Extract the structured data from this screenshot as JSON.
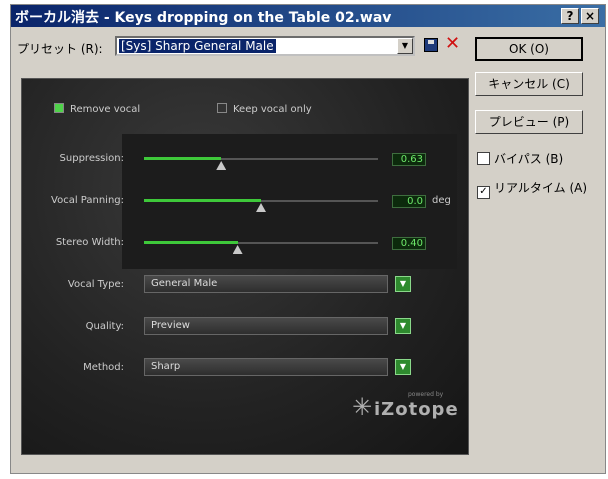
{
  "window": {
    "title": "ボーカル消去 - Keys dropping on the Table 02.wav",
    "help": "?",
    "close": "×"
  },
  "preset": {
    "label": "プリセット (R):",
    "value": "[Sys] Sharp General Male"
  },
  "buttons": {
    "ok": "OK (O)",
    "cancel": "キャンセル (C)",
    "preview": "プレビュー (P)"
  },
  "checkboxes": {
    "bypass": {
      "label": "バイパス (B)",
      "checked": false
    },
    "realtime": {
      "label": "リアルタイム (A)",
      "checked": true
    }
  },
  "plugin": {
    "mode_options": [
      {
        "label": "Remove vocal",
        "selected": true
      },
      {
        "label": "Keep vocal only",
        "selected": false
      }
    ],
    "sliders": [
      {
        "label": "Suppression:",
        "value": "0.63",
        "unit": "",
        "level": 0.33
      },
      {
        "label": "Vocal Panning:",
        "value": "0.0",
        "unit": "deg",
        "level": 0.5
      },
      {
        "label": "Stereo Width:",
        "value": "0.40",
        "unit": "",
        "level": 0.4
      }
    ],
    "selects": [
      {
        "label": "Vocal Type:",
        "value": "General Male"
      },
      {
        "label": "Quality:",
        "value": "Preview"
      },
      {
        "label": "Method:",
        "value": "Sharp"
      }
    ],
    "logo": {
      "powered": "powered by",
      "brand": "iZotope"
    }
  },
  "colors": {
    "accent_green": "#3ec83a",
    "title_bar": "#0a246a",
    "delete_red": "#d01010"
  }
}
